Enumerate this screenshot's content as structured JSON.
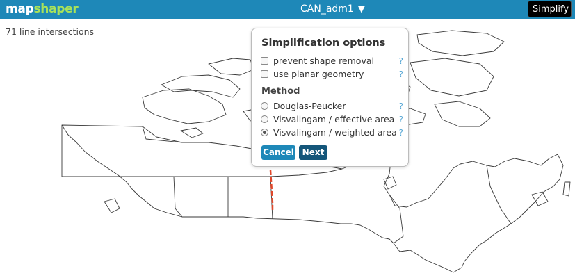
{
  "app": {
    "logo_prefix": "map",
    "logo_suffix": "shaper"
  },
  "header": {
    "layer_name": "CAN_adm1",
    "layer_arrow": "▼",
    "simplify_label": "Simplify"
  },
  "status": {
    "intersections": "71 line intersections"
  },
  "dialog": {
    "title": "Simplification options",
    "options": [
      {
        "label": "prevent shape removal",
        "checked": false,
        "help": "?"
      },
      {
        "label": "use planar geometry",
        "checked": false,
        "help": "?"
      }
    ],
    "method_title": "Method",
    "methods": [
      {
        "label": "Douglas-Peucker",
        "selected": false,
        "help": "?"
      },
      {
        "label": "Visvalingam / effective area",
        "selected": false,
        "help": "?"
      },
      {
        "label": "Visvalingam / weighted area",
        "selected": true,
        "help": "?"
      }
    ],
    "cancel_label": "Cancel",
    "next_label": "Next"
  },
  "colors": {
    "topbar": "#1e88b8",
    "logo_accent": "#a8e25a",
    "map_stroke": "#3a3a3a",
    "intersection_highlight": "#e0482b"
  }
}
